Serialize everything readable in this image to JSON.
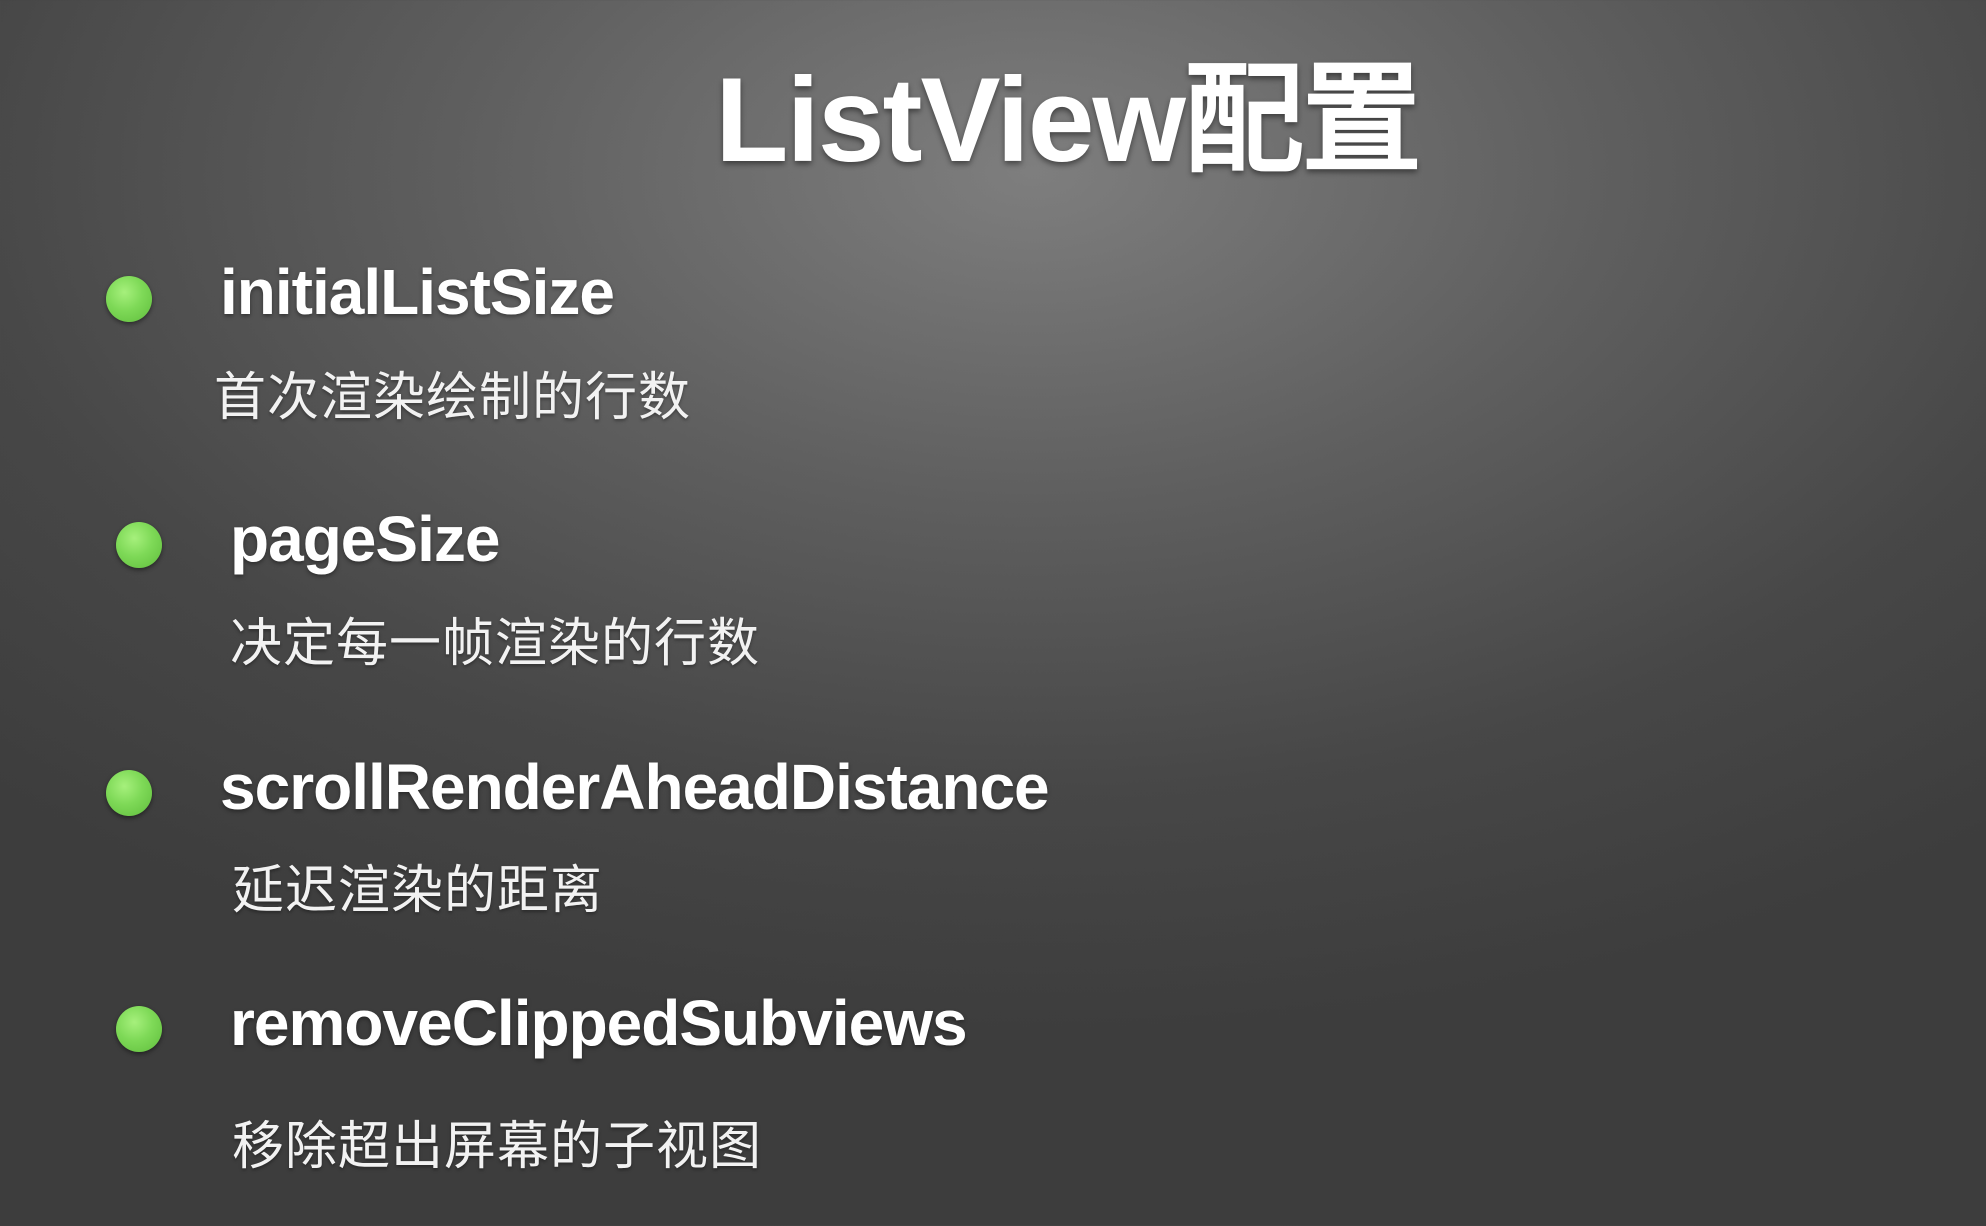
{
  "slide": {
    "title": "ListView配置",
    "items": [
      {
        "name": "initialListSize",
        "description": "首次渲染绘制的行数"
      },
      {
        "name": "pageSize",
        "description": "决定每一帧渲染的行数"
      },
      {
        "name": "scrollRenderAheadDistance",
        "description": "延迟渲染的距离"
      },
      {
        "name": "removeClippedSubviews",
        "description": "移除超出屏幕的子视图"
      }
    ]
  },
  "colors": {
    "bullet": "#7ed957",
    "text": "#ffffff",
    "background": "#5a5a5a"
  },
  "icons": {
    "bullet": "green-dot-bullet-icon"
  }
}
